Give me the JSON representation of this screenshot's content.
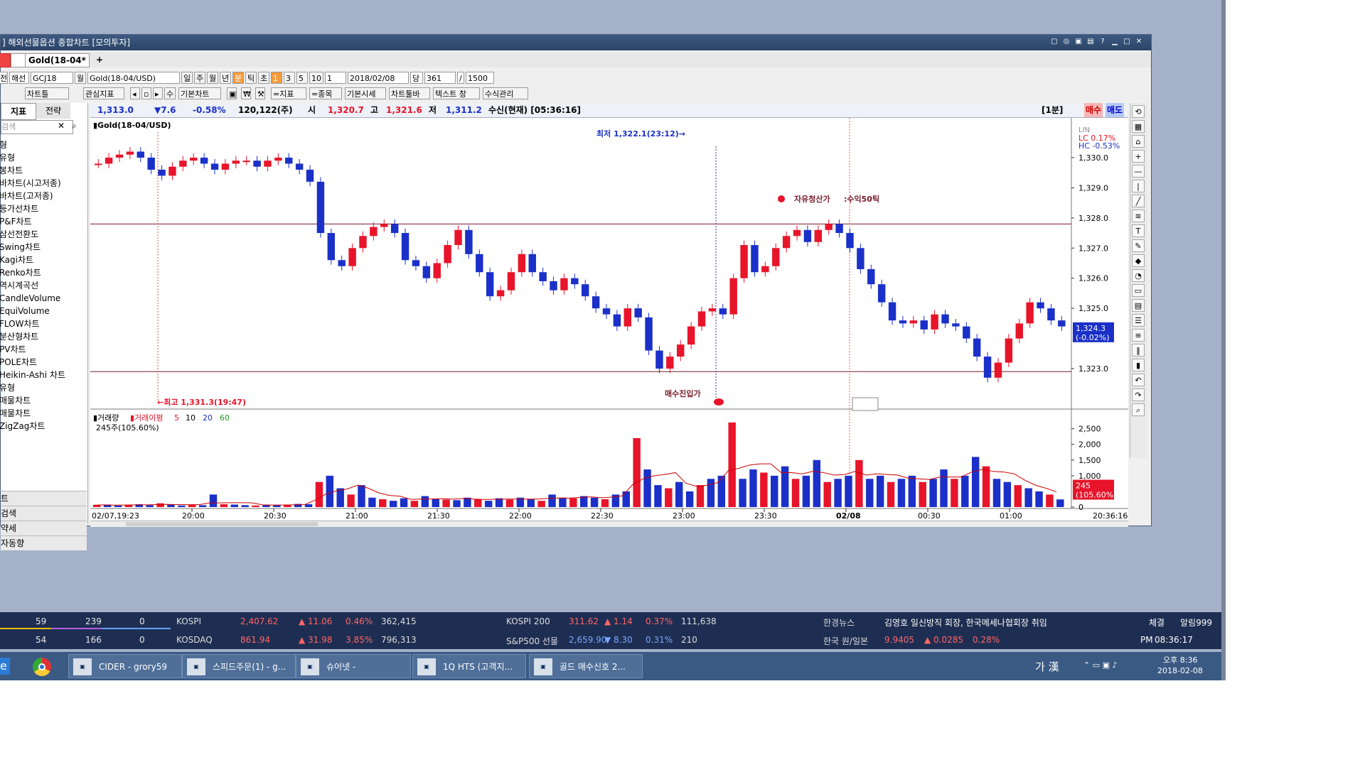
{
  "window": {
    "title": "] 해외선물옵션 종합차트 [모의투자]",
    "tab_label": "Gold(18-04*",
    "tab_add": "+"
  },
  "toolbar1": {
    "items": [
      "전",
      "해선",
      "GCJ18",
      "월",
      "Gold(18-04/USD)",
      "일",
      "주",
      "월",
      "년",
      "분",
      "틱",
      "초",
      "1",
      "3",
      "5",
      "10",
      "1",
      "2018/02/08",
      "당",
      "361",
      "/",
      "1500"
    ]
  },
  "toolbar2": {
    "items": [
      "차트틀",
      "관심지표",
      "수",
      "기본차트",
      "=지표",
      "=종목",
      "기본시세",
      "차트툴바",
      "텍스트 창",
      "수식관리"
    ]
  },
  "left_panel": {
    "tabs": [
      "지표",
      "전략"
    ],
    "search_placeholder": "검색",
    "items": [
      "형",
      "유형",
      "봉차트",
      "바차트(시고저종)",
      "바차트(고저종)",
      "등가선차트",
      "P&F차트",
      "삼선전환도",
      "Swing차트",
      "Kagi차트",
      "Renko차트",
      "역시계곡선",
      "CandleVolume",
      "EquiVolume",
      "FLOW차트",
      "분산형차트",
      "PV차트",
      "POLE차트",
      "Heikin-Ashi 차트",
      "유형",
      "매물차트",
      "매물차트",
      "ZigZag차트"
    ],
    "bottom": [
      "트",
      "검색",
      "약세",
      "자동향"
    ]
  },
  "infobar": {
    "price": "1,313.0",
    "change": "▼7.6",
    "pct": "-0.58%",
    "volume": "120,122(주)",
    "open_label": "시",
    "open": "1,320.7",
    "high_label": "고",
    "high": "1,321.6",
    "low_label": "저",
    "low": "1,311.2",
    "mode": "수신(현재) [05:36:16]",
    "interval": "[1분]",
    "buy": "매수",
    "sell": "매도"
  },
  "chart_data": {
    "type": "candlestick",
    "title": "Gold(18-04/USD)",
    "x_ticks": [
      "02/07,19:23",
      "20:00",
      "20:30",
      "21:00",
      "21:30",
      "22:00",
      "22:30",
      "23:00",
      "23:30",
      "02/08",
      "00:30",
      "01:00",
      "20:36:16"
    ],
    "y_ticks": [
      1330.0,
      1329.0,
      1328.0,
      1327.0,
      1326.0,
      1325.0,
      1323.0
    ],
    "ylim": [
      1321.8,
      1330.8
    ],
    "y_tick_labels": [
      "1,330.0",
      "1,329.0",
      "1,328.0",
      "1,327.0",
      "1,326.0",
      "1,325.0",
      "1,323.0"
    ],
    "last_price": "1,324.3",
    "last_change": "(-0.02%)",
    "lc": "LC 0.17%",
    "hc": "HC -0.53%",
    "lin": "LIN",
    "closes": [
      1329.8,
      1330.0,
      1330.1,
      1330.2,
      1330.0,
      1329.6,
      1329.4,
      1329.7,
      1329.9,
      1330.0,
      1329.8,
      1329.6,
      1329.8,
      1329.9,
      1329.9,
      1329.7,
      1329.9,
      1330.0,
      1329.8,
      1329.6,
      1329.2,
      1327.5,
      1326.6,
      1326.4,
      1327.0,
      1327.4,
      1327.7,
      1327.8,
      1327.5,
      1326.6,
      1326.4,
      1326.0,
      1326.5,
      1327.1,
      1327.6,
      1326.8,
      1326.2,
      1325.4,
      1325.6,
      1326.2,
      1326.8,
      1326.2,
      1325.9,
      1325.6,
      1326.0,
      1325.8,
      1325.4,
      1325.0,
      1324.8,
      1324.4,
      1325.0,
      1324.7,
      1323.6,
      1323.0,
      1323.4,
      1323.8,
      1324.4,
      1324.9,
      1325.0,
      1324.8,
      1326.0,
      1327.1,
      1326.2,
      1326.4,
      1327.0,
      1327.4,
      1327.6,
      1327.2,
      1327.6,
      1327.8,
      1327.5,
      1327.0,
      1326.3,
      1325.8,
      1325.2,
      1324.6,
      1324.5,
      1324.6,
      1324.3,
      1324.8,
      1324.5,
      1324.4,
      1324.0,
      1323.4,
      1322.7,
      1323.2,
      1324.0,
      1324.5,
      1325.2,
      1325.0,
      1324.6,
      1324.4
    ],
    "annotations": [
      "최저 1,322.1(23:12)",
      "최고 1,331.3(19:47)",
      "자유청산가",
      ":수익50틱",
      "매수진입가"
    ],
    "levels": [
      1327.8,
      1322.9
    ]
  },
  "volume_data": {
    "title": "거래량",
    "ma_label": "거래이평",
    "ma_periods": [
      "5",
      "10",
      "20",
      "60"
    ],
    "current": "245주(105.60%)",
    "y_ticks": [
      2500,
      2000,
      1500,
      1000,
      0
    ],
    "y_tick_labels": [
      "2,500",
      "2,000",
      "1,500",
      "1,000",
      "0"
    ],
    "ylim": [
      0,
      2900
    ],
    "last_label": "245",
    "last_pct": "(105.60%)",
    "values": [
      60,
      80,
      50,
      70,
      90,
      60,
      120,
      80,
      50,
      70,
      60,
      400,
      90,
      80,
      60,
      50,
      70,
      60,
      80,
      100,
      90,
      800,
      1000,
      600,
      400,
      700,
      300,
      250,
      200,
      280,
      200,
      350,
      260,
      240,
      220,
      300,
      250,
      200,
      280,
      240,
      300,
      250,
      200,
      400,
      300,
      280,
      350,
      300,
      250,
      400,
      500,
      2200,
      1200,
      700,
      600,
      800,
      500,
      700,
      900,
      1000,
      2700,
      900,
      1200,
      1100,
      1000,
      1300,
      900,
      1000,
      1500,
      800,
      900,
      1000,
      1500,
      900,
      1000,
      800,
      900,
      1000,
      800,
      900,
      1200,
      900,
      1000,
      1600,
      1300,
      900,
      800,
      700,
      600,
      500,
      400,
      245
    ]
  },
  "taskbar": {
    "items": [
      "CIDER - grory59",
      "스피드주문(1) - g...",
      "슈어넷 -",
      "1Q HTS (고객지...",
      "골드 매수신호 2..."
    ],
    "clock_time": "오후 8:36",
    "clock_date": "2018-02-08",
    "ime": "가 漢"
  },
  "ticker": {
    "row1": [
      "59",
      "239",
      "0",
      "KOSPI",
      "2,407.62",
      "▲ 11.06",
      "0.46%",
      "362,415",
      "KOSPI 200",
      "311.62",
      "▲ 1.14",
      "0.37%",
      "111,638",
      "한경뉴스",
      "김영호 일신방직 회장, 한국메세나협회장 취임",
      "체결",
      "알림999"
    ],
    "row2": [
      "54",
      "166",
      "0",
      "KOSDAQ",
      "861.94",
      "▲ 31.98",
      "3.85%",
      "796,313",
      "S&P500 선물",
      "2,659.90",
      "▼ 8.30",
      "0.31%",
      "210",
      "한국 원/일본",
      "9.9405",
      "▲ 0.0285",
      "0.28%",
      "PM",
      "08:36:17"
    ]
  },
  "colors": {
    "up": "#e8142a",
    "down": "#1a30c8",
    "accent": "#f79b3a",
    "title_bar": "#2b4466"
  }
}
